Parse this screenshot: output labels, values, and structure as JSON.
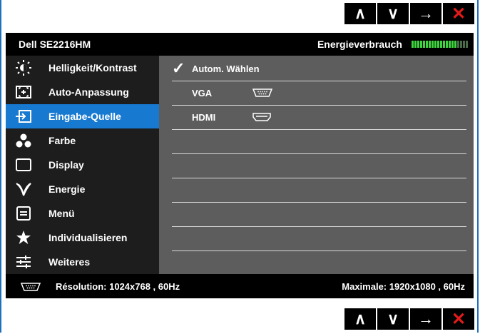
{
  "nav": {
    "up": "∧",
    "down": "∨",
    "enter": "→",
    "exit": "✕"
  },
  "header": {
    "model": "Dell  SE2216HM",
    "energy_label": "Energieverbrauch",
    "energy_level": 0.8
  },
  "menu": {
    "items": [
      {
        "label": "Helligkeit/Kontrast",
        "icon": "brightness-icon"
      },
      {
        "label": "Auto-Anpassung",
        "icon": "auto-adjust-icon"
      },
      {
        "label": "Eingabe-Quelle",
        "icon": "input-source-icon",
        "active": true
      },
      {
        "label": "Farbe",
        "icon": "color-icon"
      },
      {
        "label": "Display",
        "icon": "display-icon"
      },
      {
        "label": "Energie",
        "icon": "energy-icon"
      },
      {
        "label": "Menü",
        "icon": "menu-icon"
      },
      {
        "label": "Individualisieren",
        "icon": "star-icon"
      },
      {
        "label": "Weiteres",
        "icon": "others-icon"
      }
    ]
  },
  "content": {
    "options": [
      {
        "label": "Autom. Wählen",
        "selected": true
      },
      {
        "label": "VGA",
        "icon": "vga-connector-icon"
      },
      {
        "label": "HDMI",
        "icon": "hdmi-connector-icon"
      }
    ]
  },
  "footer": {
    "resolution": "Résolution: 1024x768 , 60Hz",
    "maximum": "Maximale: 1920x1080 , 60Hz"
  },
  "colors": {
    "accent": "#1879d1",
    "border": "#1f6fbf",
    "meter_on": "#3fd43f",
    "close": "#e11b1b"
  }
}
